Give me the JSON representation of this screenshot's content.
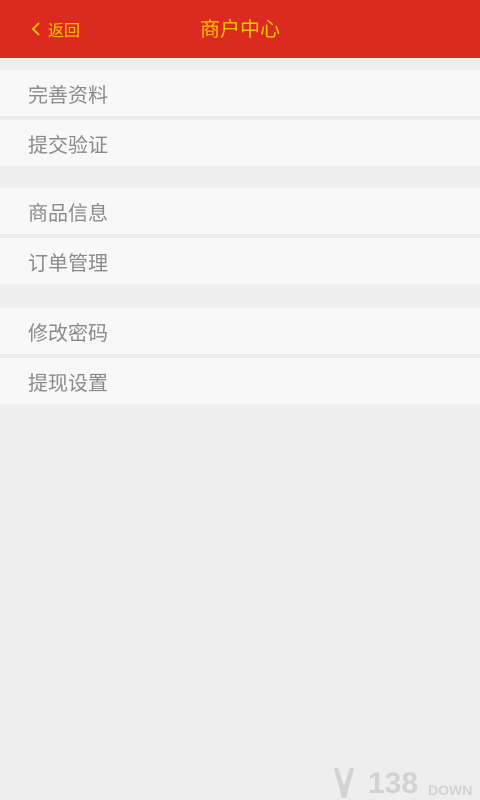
{
  "header": {
    "back_label": "返回",
    "title": "商户中心"
  },
  "groups": [
    {
      "items": [
        {
          "label": "完善资料"
        },
        {
          "label": "提交验证"
        }
      ]
    },
    {
      "items": [
        {
          "label": "商品信息"
        },
        {
          "label": "订单管理"
        }
      ]
    },
    {
      "items": [
        {
          "label": "修改密码"
        },
        {
          "label": "提现设置"
        }
      ]
    }
  ],
  "watermark": {
    "number": "138",
    "suffix": "DOWN"
  },
  "colors": {
    "header_bg": "#dc2a20",
    "header_text": "#f7c600",
    "item_bg": "#f8f8f8",
    "item_text": "#8a8a8a",
    "page_bg": "#eeeeee"
  }
}
